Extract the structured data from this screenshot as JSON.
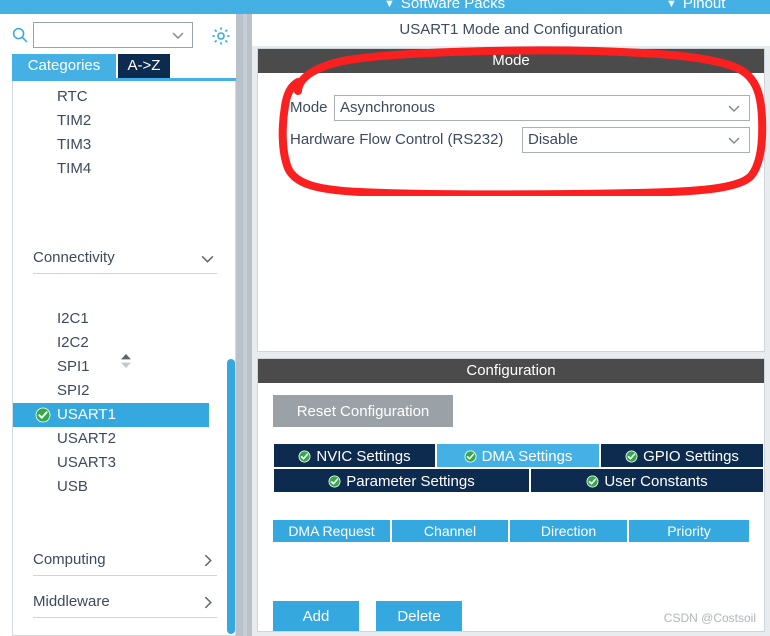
{
  "ribbon": {
    "items": [
      {
        "label": "Software Packs",
        "caret": "chevron-down-icon"
      },
      {
        "label": "Pinout",
        "caret": "chevron-down-icon"
      }
    ]
  },
  "sidebar": {
    "search": {
      "value": "",
      "placeholder": "",
      "icon": "search-icon",
      "chevron": "chevron-down-icon"
    },
    "gear": "gear-icon",
    "tabs": [
      {
        "label": "Categories",
        "active": true
      },
      {
        "label": "A->Z",
        "active": false
      }
    ],
    "peripherals_top": [
      "RTC",
      "TIM2",
      "TIM3",
      "TIM4"
    ],
    "groups": [
      {
        "label": "Connectivity",
        "state": "expanded",
        "icon": "chevron-down-icon"
      },
      {
        "label": "Computing",
        "state": "collapsed",
        "icon": "chevron-right-icon"
      },
      {
        "label": "Middleware",
        "state": "collapsed",
        "icon": "chevron-right-icon"
      }
    ],
    "connectivity_items": [
      {
        "label": "I2C1",
        "checked": false,
        "selected": false
      },
      {
        "label": "I2C2",
        "checked": false,
        "selected": false
      },
      {
        "label": "SPI1",
        "checked": false,
        "selected": false
      },
      {
        "label": "SPI2",
        "checked": false,
        "selected": false
      },
      {
        "label": "USART1",
        "checked": true,
        "selected": true
      },
      {
        "label": "USART2",
        "checked": false,
        "selected": false
      },
      {
        "label": "USART3",
        "checked": false,
        "selected": false
      },
      {
        "label": "USB",
        "checked": false,
        "selected": false
      }
    ],
    "sort_spinner": "sort-updown-icon"
  },
  "main": {
    "title": "USART1 Mode and Configuration",
    "mode_section": {
      "heading": "Mode",
      "fields": [
        {
          "label": "Mode",
          "value": "Asynchronous",
          "chevron": "chevron-down-icon"
        },
        {
          "label": "Hardware Flow Control (RS232)",
          "value": "Disable",
          "chevron": "chevron-down-icon"
        }
      ]
    },
    "config_section": {
      "heading": "Configuration",
      "reset_label": "Reset Configuration",
      "tabs": [
        {
          "label": "NVIC Settings",
          "active": false,
          "icon": "check-circle-icon"
        },
        {
          "label": "DMA Settings",
          "active": true,
          "icon": "check-circle-icon"
        },
        {
          "label": "GPIO Settings",
          "active": false,
          "icon": "check-circle-icon"
        },
        {
          "label": "Parameter Settings",
          "active": false,
          "icon": "check-circle-icon"
        },
        {
          "label": "User Constants",
          "active": false,
          "icon": "check-circle-icon"
        }
      ],
      "table": {
        "columns": [
          "DMA Request",
          "Channel",
          "Direction",
          "Priority"
        ],
        "rows": []
      },
      "buttons": [
        {
          "label": "Add"
        },
        {
          "label": "Delete"
        }
      ]
    }
  },
  "watermark": "CSDN @Costsoil",
  "colors": {
    "accent_blue": "#35a8e0",
    "ribbon_blue": "#45b0e3",
    "tab_navy": "#0d2b4f",
    "section_grey": "#4b4b4b",
    "annotation_red": "#fb2020",
    "check_green": "#35a84a"
  }
}
